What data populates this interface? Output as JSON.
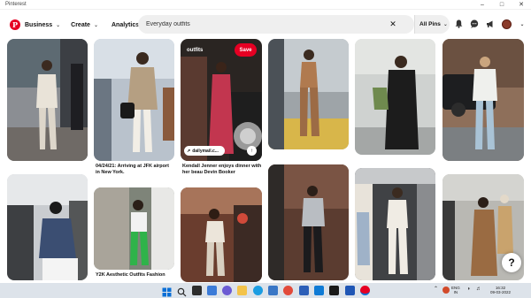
{
  "window": {
    "title": "Pinterest"
  },
  "header": {
    "logo": "P",
    "menu": [
      {
        "label": "Business"
      },
      {
        "label": "Create"
      },
      {
        "label": "Analytics"
      }
    ],
    "search": {
      "value": "Everyday outfits",
      "placeholder": "Search"
    },
    "scope": "All Pins"
  },
  "pins": [
    {
      "caption": ""
    },
    {
      "caption_line1": "04/24/21: Arriving at JFK airport",
      "caption_line2": "in New York."
    },
    {
      "overlay_label": "outfits",
      "save_label": "Save",
      "link_label": "dailymail.c...",
      "caption_line1": "Kendall Jenner enjoys dinner with",
      "caption_line2": "her beau Devin Booker"
    },
    {
      "caption": ""
    },
    {
      "caption": ""
    },
    {
      "caption": ""
    },
    {
      "caption": ""
    },
    {
      "caption_line1": "Y2K Aesthetic Outfits Fashion"
    },
    {
      "caption": ""
    },
    {
      "caption": ""
    },
    {
      "caption": ""
    },
    {
      "caption": ""
    }
  ],
  "help_label": "?",
  "taskbar": {
    "lang_line1": "ENG",
    "lang_line2": "IN",
    "time": "16:32",
    "date": "09-03-2022"
  },
  "colors": {
    "brand": "#e60023",
    "taskbar": "#dde3ea"
  },
  "icons": [
    "pinterest-logo",
    "search-clear-icon",
    "bell-icon",
    "chat-icon",
    "megaphone-icon",
    "chevron-down-icon",
    "help-icon",
    "windows-start-icon"
  ]
}
